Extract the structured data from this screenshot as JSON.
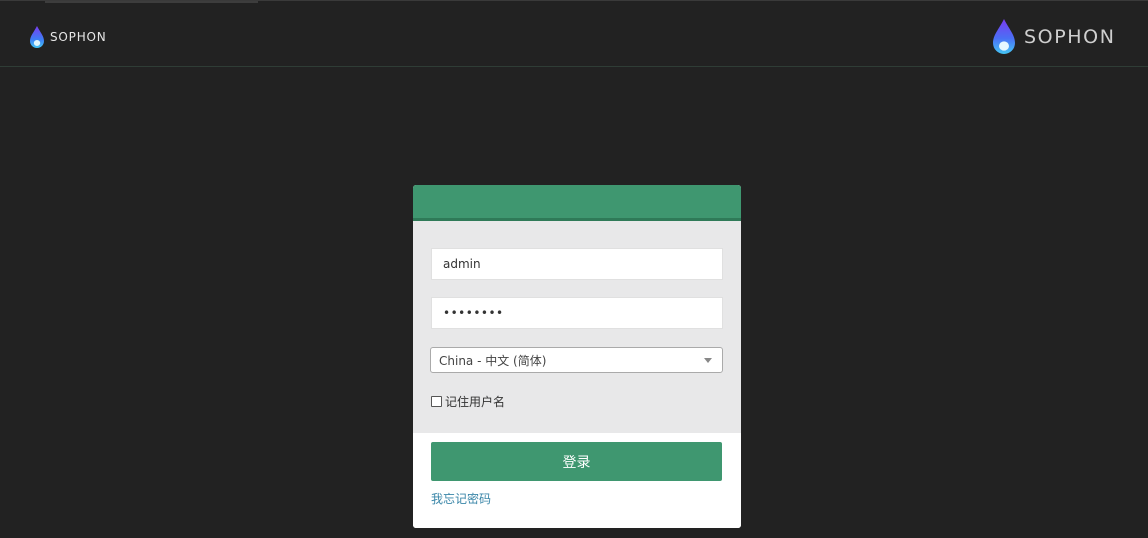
{
  "header": {
    "brand_small": "SOPHON",
    "brand_large": "SOPHON"
  },
  "login": {
    "username_value": "admin",
    "password_masked": "••••••••",
    "language_selected": "China - 中文 (简体)",
    "remember_label": "记住用户名",
    "remember_checked": false,
    "submit_label": "登录",
    "forgot_label": "我忘记密码"
  },
  "colors": {
    "background": "#222222",
    "accent": "#3f9770",
    "link": "#3a86a8"
  },
  "icons": {
    "logo": "flame-drop-logo-icon",
    "select_caret": "chevron-down-icon"
  }
}
